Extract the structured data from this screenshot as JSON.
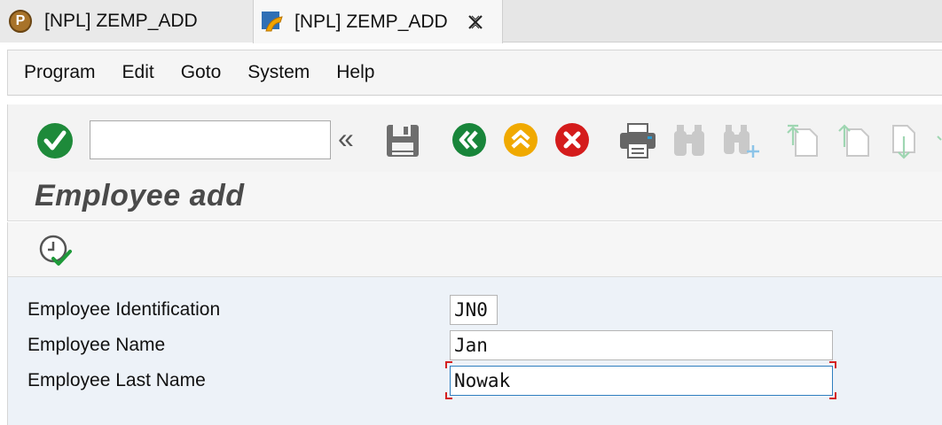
{
  "tabs": [
    {
      "label": "[NPL] ZEMP_ADD",
      "icon": "p-circle-icon"
    },
    {
      "label": "[NPL] ZEMP_ADD",
      "icon": "sap-session-icon",
      "active": true
    }
  ],
  "menu": [
    "Program",
    "Edit",
    "Goto",
    "System",
    "Help"
  ],
  "toolbar": {
    "command_value": "",
    "expand_glyph": "«"
  },
  "page": {
    "title": "Employee add"
  },
  "form": {
    "fields": [
      {
        "label": "Employee Identification",
        "value": "JN0"
      },
      {
        "label": "Employee Name",
        "value": "Jan"
      },
      {
        "label": "Employee Last Name",
        "value": "Nowak"
      }
    ]
  },
  "colors": {
    "enter_green": "#1e8a3a",
    "back_green": "#18853a",
    "exit_yellow": "#f0a900",
    "cancel_red": "#d41c1c",
    "form_bg": "#edf2f8",
    "focus_blue": "#2f7fc0",
    "required_red": "#d42020"
  }
}
